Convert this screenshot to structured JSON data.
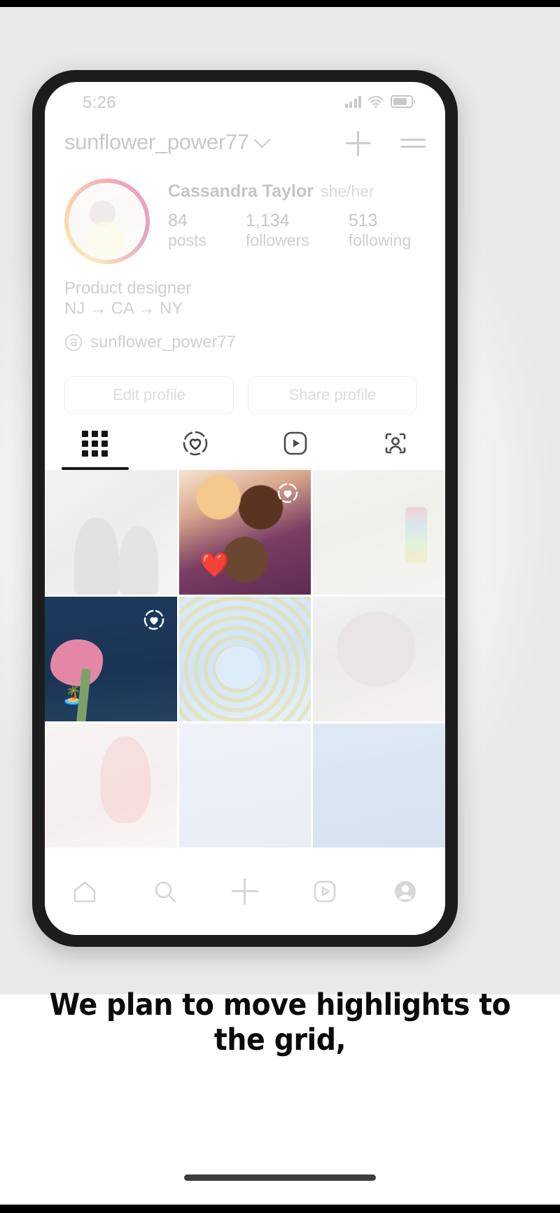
{
  "status_bar": {
    "time": "5:26",
    "icons": [
      "cellular-signal",
      "wifi",
      "battery"
    ]
  },
  "app_header": {
    "username": "sunflower_power77",
    "dropdown_icon": "chevron-down-icon",
    "add_icon": "plus-icon",
    "menu_icon": "hamburger-menu-icon"
  },
  "profile": {
    "avatar_alt": "profile-photo",
    "full_name": "Cassandra Taylor",
    "pronouns": "she/her",
    "stats": [
      {
        "number": "84",
        "label": "posts"
      },
      {
        "number": "1,134",
        "label": "followers"
      },
      {
        "number": "513",
        "label": "following"
      }
    ],
    "bio_lines": [
      "Product designer",
      "NJ → CA → NY"
    ],
    "threads": {
      "icon": "threads-icon",
      "handle": "sunflower_power77"
    },
    "buttons": [
      {
        "label": "Edit profile"
      },
      {
        "label": "Share profile"
      }
    ]
  },
  "tabs": [
    {
      "name": "grid",
      "icon": "grid-icon",
      "active": true
    },
    {
      "name": "highlights",
      "icon": "highlight-heart-icon",
      "active": false
    },
    {
      "name": "reels",
      "icon": "reels-play-icon",
      "active": false
    },
    {
      "name": "tagged",
      "icon": "tagged-person-icon",
      "active": false
    }
  ],
  "grid_cells": [
    {
      "id": "cell-1",
      "badge": "",
      "sticker": ""
    },
    {
      "id": "cell-2",
      "badge": "highlight-badge",
      "sticker": "❤️"
    },
    {
      "id": "cell-3",
      "badge": "",
      "sticker": ""
    },
    {
      "id": "cell-4",
      "badge": "highlight-badge",
      "sticker": "🏝️"
    },
    {
      "id": "cell-5",
      "badge": "",
      "sticker": ""
    },
    {
      "id": "cell-6",
      "badge": "",
      "sticker": ""
    },
    {
      "id": "cell-7",
      "badge": "",
      "sticker": ""
    },
    {
      "id": "cell-8",
      "badge": "",
      "sticker": ""
    },
    {
      "id": "cell-9",
      "badge": "",
      "sticker": ""
    }
  ],
  "bottom_nav": [
    {
      "name": "home",
      "icon": "home-icon"
    },
    {
      "name": "search",
      "icon": "search-icon"
    },
    {
      "name": "create",
      "icon": "plus-icon"
    },
    {
      "name": "reels",
      "icon": "reels-play-icon"
    },
    {
      "name": "profile",
      "icon": "profile-avatar-icon"
    }
  ],
  "caption": "We plan to move highlights to the grid,",
  "colors": {
    "accent_ring": "#e1306c",
    "text_dark": "#0b0b0b",
    "muted": "#cfcfcf"
  }
}
